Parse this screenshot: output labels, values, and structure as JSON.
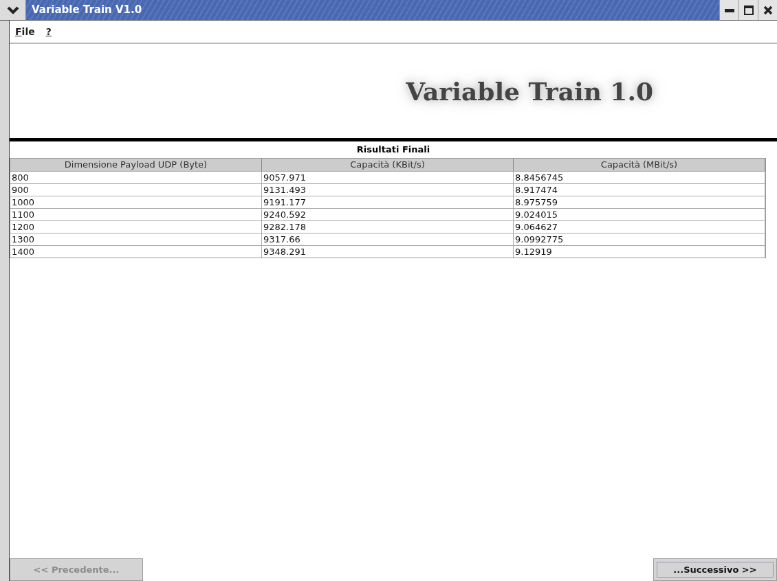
{
  "window": {
    "title": "Variable Train V1.0"
  },
  "menu": [
    {
      "label": "File"
    },
    {
      "label": "?"
    }
  ],
  "banner": {
    "title": "Variable Train 1.0"
  },
  "table": {
    "title": "Risultati Finali",
    "columns": [
      "Dimensione Payload UDP (Byte)",
      "Capacità (KBit/s)",
      "Capacità (MBit/s)"
    ],
    "rows": [
      [
        "800",
        "9057.971",
        "8.8456745"
      ],
      [
        "900",
        "9131.493",
        "8.917474"
      ],
      [
        "1000",
        "9191.177",
        "8.975759"
      ],
      [
        "1100",
        "9240.592",
        "9.024015"
      ],
      [
        "1200",
        "9282.178",
        "9.064627"
      ],
      [
        "1300",
        "9317.66",
        "9.0992775"
      ],
      [
        "1400",
        "9348.291",
        "9.12919"
      ]
    ]
  },
  "buttons": [
    {
      "label": "<< Precedente...",
      "disabled": true,
      "focused": false
    },
    {
      "label": "...Successivo >>",
      "disabled": false,
      "focused": true
    }
  ]
}
